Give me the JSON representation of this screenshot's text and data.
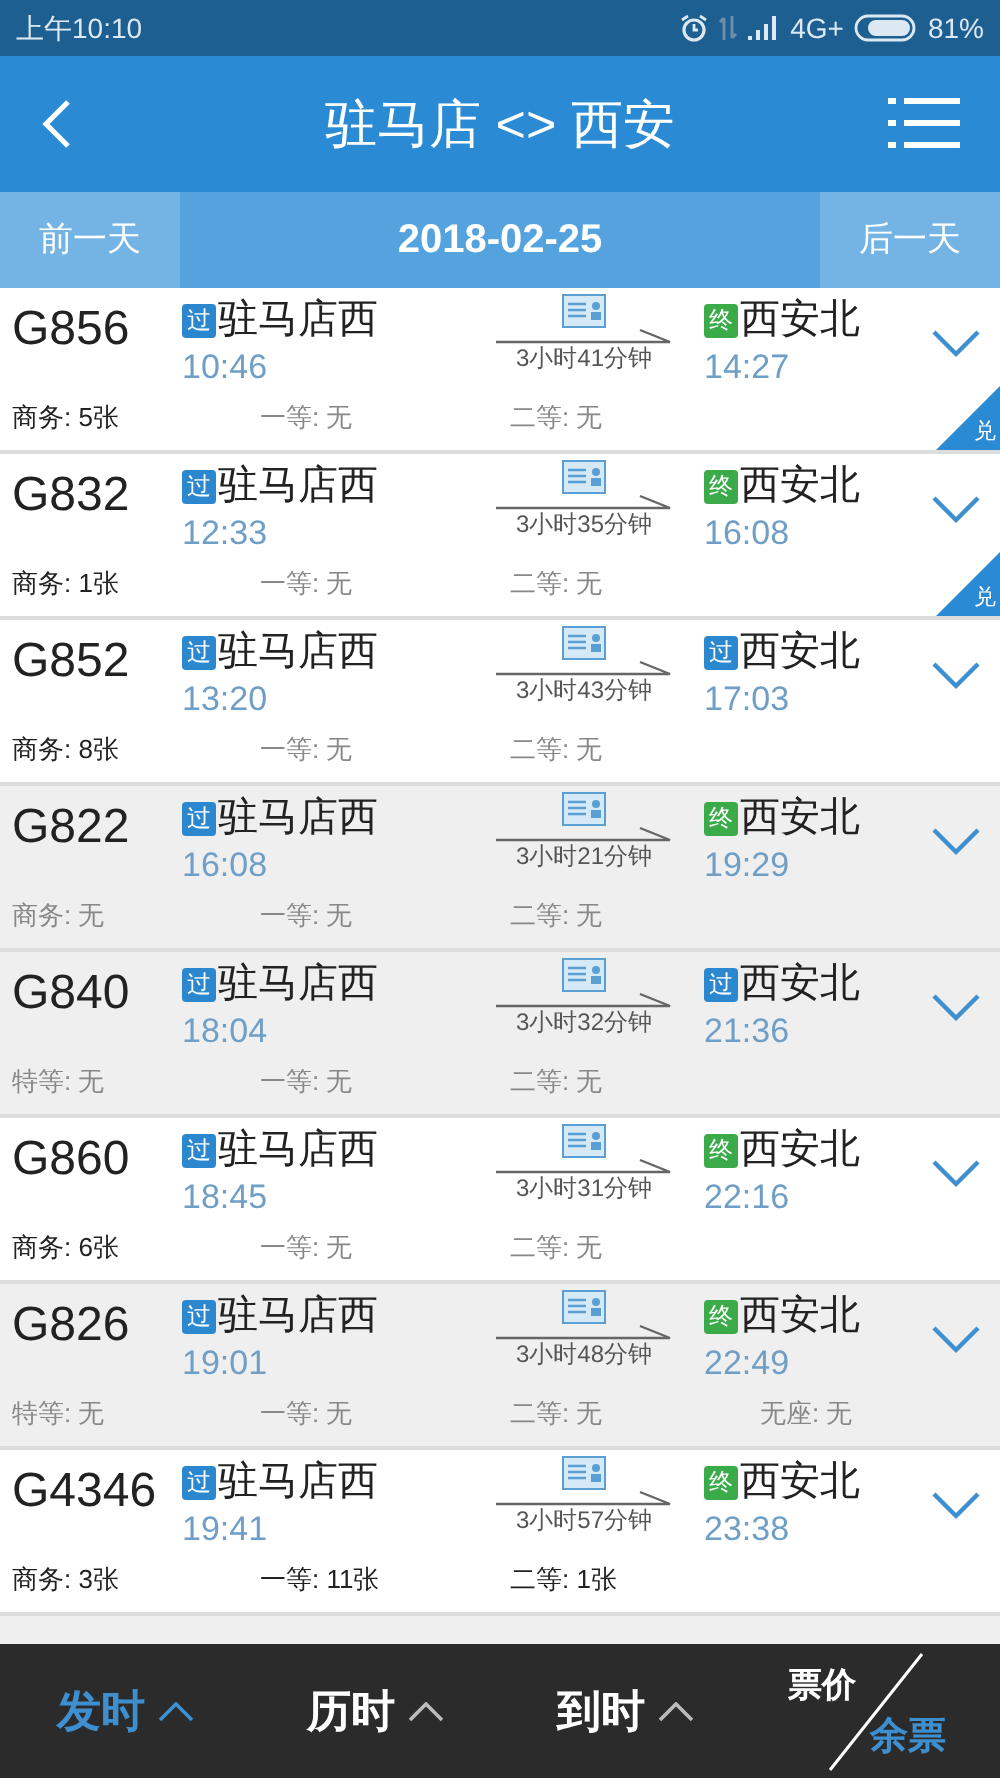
{
  "status_bar": {
    "time": "上午10:10",
    "network": "4G+",
    "battery": "81%"
  },
  "header": {
    "title": "驻马店 <> 西安"
  },
  "date_bar": {
    "prev": "前一天",
    "date": "2018-02-25",
    "next": "后一天"
  },
  "trains": [
    {
      "number": "G856",
      "from": {
        "badge": "过",
        "kind": "pass",
        "station": "驻马店西",
        "time": "10:46"
      },
      "duration": "3小时41分钟",
      "to": {
        "badge": "终",
        "kind": "end",
        "station": "西安北",
        "time": "14:27"
      },
      "seats": [
        {
          "text": "商务: 5张",
          "available": true
        },
        {
          "text": "一等: 无",
          "available": false
        },
        {
          "text": "二等: 无",
          "available": false
        }
      ],
      "sold_out": false,
      "exchange": "兑"
    },
    {
      "number": "G832",
      "from": {
        "badge": "过",
        "kind": "pass",
        "station": "驻马店西",
        "time": "12:33"
      },
      "duration": "3小时35分钟",
      "to": {
        "badge": "终",
        "kind": "end",
        "station": "西安北",
        "time": "16:08"
      },
      "seats": [
        {
          "text": "商务: 1张",
          "available": true
        },
        {
          "text": "一等: 无",
          "available": false
        },
        {
          "text": "二等: 无",
          "available": false
        }
      ],
      "sold_out": false,
      "exchange": "兑"
    },
    {
      "number": "G852",
      "from": {
        "badge": "过",
        "kind": "pass",
        "station": "驻马店西",
        "time": "13:20"
      },
      "duration": "3小时43分钟",
      "to": {
        "badge": "过",
        "kind": "pass",
        "station": "西安北",
        "time": "17:03"
      },
      "seats": [
        {
          "text": "商务: 8张",
          "available": true
        },
        {
          "text": "一等: 无",
          "available": false
        },
        {
          "text": "二等: 无",
          "available": false
        }
      ],
      "sold_out": false
    },
    {
      "number": "G822",
      "from": {
        "badge": "过",
        "kind": "pass",
        "station": "驻马店西",
        "time": "16:08"
      },
      "duration": "3小时21分钟",
      "to": {
        "badge": "终",
        "kind": "end",
        "station": "西安北",
        "time": "19:29"
      },
      "seats": [
        {
          "text": "商务: 无",
          "available": false
        },
        {
          "text": "一等: 无",
          "available": false
        },
        {
          "text": "二等: 无",
          "available": false
        }
      ],
      "sold_out": true
    },
    {
      "number": "G840",
      "from": {
        "badge": "过",
        "kind": "pass",
        "station": "驻马店西",
        "time": "18:04"
      },
      "duration": "3小时32分钟",
      "to": {
        "badge": "过",
        "kind": "pass",
        "station": "西安北",
        "time": "21:36"
      },
      "seats": [
        {
          "text": "特等: 无",
          "available": false
        },
        {
          "text": "一等: 无",
          "available": false
        },
        {
          "text": "二等: 无",
          "available": false
        }
      ],
      "sold_out": true
    },
    {
      "number": "G860",
      "from": {
        "badge": "过",
        "kind": "pass",
        "station": "驻马店西",
        "time": "18:45"
      },
      "duration": "3小时31分钟",
      "to": {
        "badge": "终",
        "kind": "end",
        "station": "西安北",
        "time": "22:16"
      },
      "seats": [
        {
          "text": "商务: 6张",
          "available": true
        },
        {
          "text": "一等: 无",
          "available": false
        },
        {
          "text": "二等: 无",
          "available": false
        }
      ],
      "sold_out": false
    },
    {
      "number": "G826",
      "from": {
        "badge": "过",
        "kind": "pass",
        "station": "驻马店西",
        "time": "19:01"
      },
      "duration": "3小时48分钟",
      "to": {
        "badge": "终",
        "kind": "end",
        "station": "西安北",
        "time": "22:49"
      },
      "seats": [
        {
          "text": "特等: 无",
          "available": false
        },
        {
          "text": "一等: 无",
          "available": false
        },
        {
          "text": "二等: 无",
          "available": false
        },
        {
          "text": "无座: 无",
          "available": false
        }
      ],
      "sold_out": true
    },
    {
      "number": "G4346",
      "from": {
        "badge": "过",
        "kind": "pass",
        "station": "驻马店西",
        "time": "19:41"
      },
      "duration": "3小时57分钟",
      "to": {
        "badge": "终",
        "kind": "end",
        "station": "西安北",
        "time": "23:38"
      },
      "seats": [
        {
          "text": "商务: 3张",
          "available": true
        },
        {
          "text": "一等: 11张",
          "available": true
        },
        {
          "text": "二等: 1张",
          "available": true
        }
      ],
      "sold_out": false
    }
  ],
  "sort_bar": {
    "tabs": [
      {
        "label": "发时",
        "selected": true
      },
      {
        "label": "历时",
        "selected": false
      },
      {
        "label": "到时",
        "selected": false
      }
    ],
    "price": {
      "top": "票价",
      "bottom": "余票"
    }
  }
}
